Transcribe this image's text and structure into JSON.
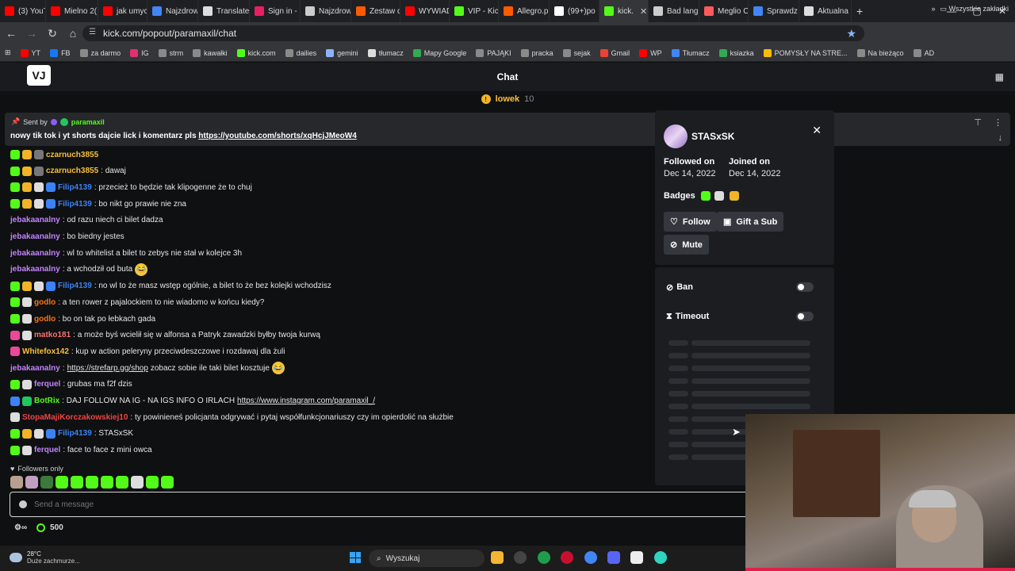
{
  "browser": {
    "tabs": [
      {
        "label": "(3) YouTu",
        "color": "#ff0000"
      },
      {
        "label": "Mielno 2(",
        "color": "#ff0000"
      },
      {
        "label": "jak umyc",
        "color": "#ff0000"
      },
      {
        "label": "Najzdrow",
        "color": "#4285f4"
      },
      {
        "label": "Translate",
        "color": "#dddddd"
      },
      {
        "label": "Sign in -",
        "color": "#e91e63"
      },
      {
        "label": "Najzdrow",
        "color": "#cccccc"
      },
      {
        "label": "Zestaw d",
        "color": "#ff5a00"
      },
      {
        "label": "WYWIAD",
        "color": "#ff0000"
      },
      {
        "label": "VIP - Kick",
        "color": "#53fc18"
      },
      {
        "label": "Allegro.p",
        "color": "#ff5a00"
      },
      {
        "label": "(99+)po",
        "color": "#ffffff"
      },
      {
        "label": "kick.",
        "color": "#53fc18",
        "active": true
      },
      {
        "label": "Bad lang",
        "color": "#cccccc"
      },
      {
        "label": "Meglio C",
        "color": "#ff5a5a"
      },
      {
        "label": "Sprawdz",
        "color": "#4285f4"
      },
      {
        "label": "Aktualna",
        "color": "#dddddd"
      }
    ],
    "active_tab_close": "✕",
    "new_tab": "+",
    "url": "kick.com/popout/paramaxil/chat",
    "bookmarks": [
      {
        "label": "YT",
        "color": "#ff0000"
      },
      {
        "label": "FB",
        "color": "#1877f2"
      },
      {
        "label": "za darmo",
        "color": "#8a8a8a"
      },
      {
        "label": "IG",
        "color": "#e1306c"
      },
      {
        "label": "strm",
        "color": "#8a8a8a"
      },
      {
        "label": "kawałki",
        "color": "#8a8a8a"
      },
      {
        "label": "kick.com",
        "color": "#53fc18"
      },
      {
        "label": "dailies",
        "color": "#8a8a8a"
      },
      {
        "label": "gemini",
        "color": "#8ab4f8"
      },
      {
        "label": "tłumacz",
        "color": "#dddddd"
      },
      {
        "label": "Mapy Google",
        "color": "#34a853"
      },
      {
        "label": "PAJĄKI",
        "color": "#8a8a8a"
      },
      {
        "label": "pracka",
        "color": "#8a8a8a"
      },
      {
        "label": "sejak",
        "color": "#8a8a8a"
      },
      {
        "label": "Gmail",
        "color": "#ea4335"
      },
      {
        "label": "WP",
        "color": "#ff0000"
      },
      {
        "label": "Tłumacz",
        "color": "#4285f4"
      },
      {
        "label": "ksiazka",
        "color": "#34a853"
      },
      {
        "label": "POMYSŁY NA STRE...",
        "color": "#fbbc05"
      },
      {
        "label": "Na bieżąco",
        "color": "#8a8a8a"
      },
      {
        "label": "AD",
        "color": "#8a8a8a"
      }
    ],
    "bookmarks_more": "»",
    "all_bookmarks": "Wszystkie zakładki"
  },
  "kick": {
    "logo": "VJ",
    "title": "Chat",
    "sub_user": "lowek",
    "sub_count": "10",
    "pinned": {
      "sent_by": "Sent by",
      "sender": "paramaxil",
      "text": "nowy tik tok i yt shorts dajcie lick i komentarz pls",
      "link": "https://youtube.com/shorts/xqHcjJMeoW4"
    },
    "messages": [
      {
        "user": "czarnuch3855",
        "color": "#f7c03c",
        "text": "",
        "badges": [
          "#53fc18",
          "#f0b429",
          "#777"
        ]
      },
      {
        "user": "czarnuch3855",
        "color": "#f7c03c",
        "text": ": dawaj",
        "badges": [
          "#53fc18",
          "#f0b429",
          "#777"
        ]
      },
      {
        "user": "Filip4139",
        "color": "#3b82f6",
        "text": ": przecież to będzie tak klipogenne że to chuj",
        "badges": [
          "#53fc18",
          "#f0b429",
          "#dddddd",
          "#3b82f6"
        ]
      },
      {
        "user": "Filip4139",
        "color": "#3b82f6",
        "text": ": bo nikt go prawie nie zna",
        "badges": [
          "#53fc18",
          "#f0b429",
          "#dddddd",
          "#3b82f6"
        ]
      },
      {
        "user": "jebakaanalny",
        "color": "#c084fc",
        "text": ": od razu niech ci bilet dadza",
        "badges": []
      },
      {
        "user": "jebakaanalny",
        "color": "#c084fc",
        "text": ": bo biedny jestes",
        "badges": []
      },
      {
        "user": "jebakaanalny",
        "color": "#c084fc",
        "text": ": wl to whitelist a bilet to zebys nie stał w kolejce 3h",
        "badges": []
      },
      {
        "user": "jebakaanalny",
        "color": "#c084fc",
        "text": ": a wchodził od buta",
        "badges": [],
        "emoji": "😂"
      },
      {
        "user": "Filip4139",
        "color": "#3b82f6",
        "text": ": no wl to że masz wstęp ogólnie, a bilet to że bez kolejki wchodzisz",
        "badges": [
          "#53fc18",
          "#f0b429",
          "#dddddd",
          "#3b82f6"
        ]
      },
      {
        "user": "godlo",
        "color": "#f97316",
        "text": ": a ten rower z pajalockiem to nie wiadomo w końcu kiedy?",
        "badges": [
          "#53fc18",
          "#dddddd"
        ]
      },
      {
        "user": "godlo",
        "color": "#f97316",
        "text": ": bo on tak po łebkach gada",
        "badges": [
          "#53fc18",
          "#dddddd"
        ]
      },
      {
        "user": "matko181",
        "color": "#f87171",
        "text": ": a może byś wcielił się w alfonsa a Patryk zawadzki byłby twoja kurwą",
        "badges": [
          "#ec4899",
          "#dddddd"
        ]
      },
      {
        "user": "Whitefox142",
        "color": "#f7c03c",
        "text": ": kup w action peleryny przeciwdeszczowe i rozdawaj dla żuli",
        "badges": [
          "#ec4899"
        ]
      },
      {
        "user": "jebakaanalny",
        "color": "#c084fc",
        "text": ": ",
        "link": "https://strefarp.gg/shop",
        "after": " zobacz sobie ile taki bilet kosztuje",
        "badges": [],
        "emoji": "😂"
      },
      {
        "user": "ferquel",
        "color": "#c084fc",
        "text": ": grubas ma f2f dzis",
        "badges": [
          "#53fc18",
          "#dddddd"
        ]
      },
      {
        "user": "BotRix",
        "color": "#53fc18",
        "text": ": DAJ FOLLOW NA IG - NA IGS INFO O IRLACH ",
        "link": "https://www.instagram.com/paramaxil_/",
        "badges": [
          "#3b82f6",
          "#22c55e"
        ]
      },
      {
        "user": "StopaMajiKorczakowskiej10",
        "color": "#ef4444",
        "text": ": ty powinieneś policjanta odgrywać i pytaj współfunkcjonariuszy czy im opierdolić na służbie",
        "badges": [
          "#dddddd"
        ]
      },
      {
        "user": "Filip4139",
        "color": "#3b82f6",
        "text": ": STASxSK",
        "badges": [
          "#53fc18",
          "#f0b429",
          "#dddddd",
          "#3b82f6"
        ]
      },
      {
        "user": "ferquel",
        "color": "#c084fc",
        "text": ": face to face z mini owca",
        "badges": [
          "#53fc18",
          "#dddddd"
        ]
      }
    ],
    "followers_only": "Followers only",
    "input_placeholder": "Send a message",
    "points": "500"
  },
  "profile": {
    "name": "STASxSK",
    "followed_label": "Followed on",
    "followed_date": "Dec 14, 2022",
    "joined_label": "Joined on",
    "joined_date": "Dec 14, 2022",
    "badges_label": "Badges",
    "follow": "Follow",
    "gift": "Gift a Sub",
    "mute": "Mute",
    "ban": "Ban",
    "timeout": "Timeout"
  },
  "taskbar": {
    "temp": "28°C",
    "weather": "Duże zachmurze...",
    "search": "Wyszukaj"
  },
  "colors": {
    "kick_green": "#53fc18",
    "accent_blue": "#8ab4f8"
  }
}
